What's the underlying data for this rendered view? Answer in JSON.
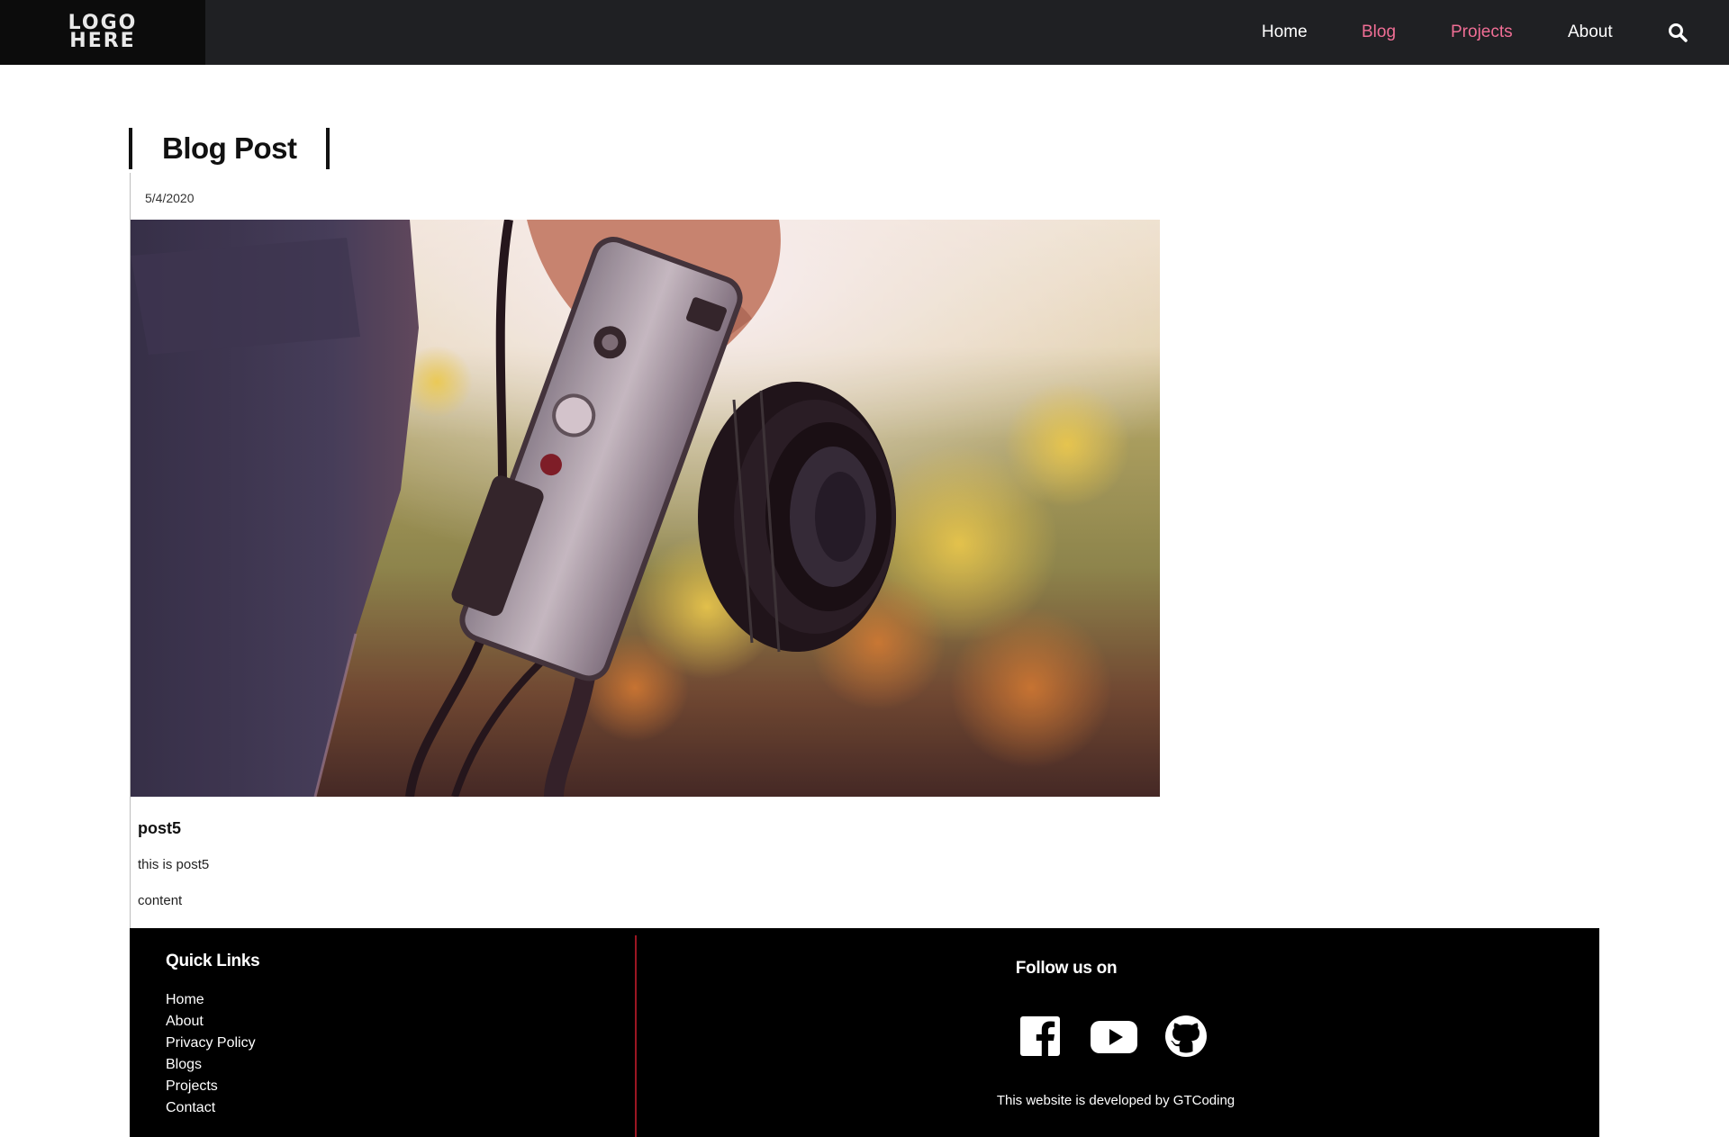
{
  "logo": {
    "line1": "LOGO",
    "line2": "HERE"
  },
  "nav": {
    "items": [
      {
        "label": "Home",
        "color": "#ffffff"
      },
      {
        "label": "Blog",
        "color": "#f06e95"
      },
      {
        "label": "Projects",
        "color": "#f06e95"
      },
      {
        "label": "About",
        "color": "#ffffff"
      }
    ],
    "search_icon": "search-icon"
  },
  "page": {
    "heading": "Blog Post"
  },
  "post": {
    "date": "5/4/2020",
    "image_icon": "camera-photo",
    "title": "post5",
    "excerpt": "this is post5",
    "content": "content"
  },
  "footer": {
    "quick_links_title": "Quick Links",
    "quick_links": [
      "Home",
      "About",
      "Privacy Policy",
      "Blogs",
      "Projects",
      "Contact"
    ],
    "follow_title": "Follow us on",
    "social_icons": [
      "facebook-icon",
      "youtube-icon",
      "github-icon"
    ],
    "credit": "This website is developed by GTCoding",
    "divider_color": "#9b1622"
  },
  "colors": {
    "navbar_bg": "#1f2023",
    "logo_bg": "#0c0c0c",
    "accent": "#f06e95",
    "footer_bg": "#000000"
  }
}
